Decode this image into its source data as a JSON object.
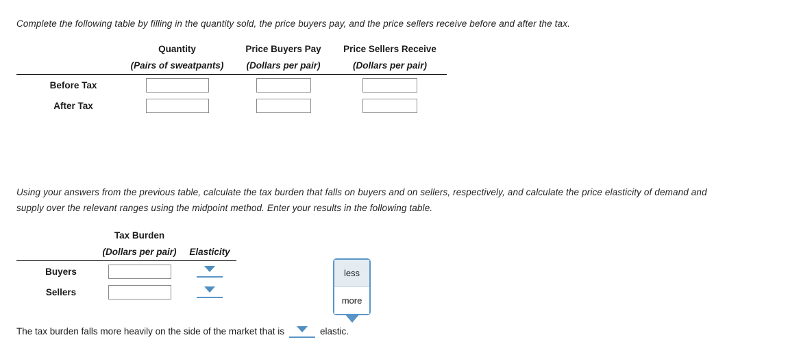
{
  "prompts": {
    "first": "Complete the following table by filling in the quantity sold, the price buyers pay, and the price sellers receive before and after the tax.",
    "second": "Using your answers from the previous table, calculate the tax burden that falls on buyers and on sellers, respectively, and calculate the price elasticity of demand and supply over the relevant ranges using the midpoint method. Enter your results in the following table."
  },
  "table_one": {
    "headers_main": [
      "",
      "Quantity",
      "Price Buyers Pay",
      "Price Sellers Receive"
    ],
    "headers_sub": [
      "",
      "(Pairs of sweatpants)",
      "(Dollars per pair)",
      "(Dollars per pair)"
    ],
    "rows": [
      {
        "label": "Before Tax",
        "quantity": "",
        "price_buyers_pay": "",
        "price_sellers_receive": ""
      },
      {
        "label": "After Tax",
        "quantity": "",
        "price_buyers_pay": "",
        "price_sellers_receive": ""
      }
    ],
    "input_placeholder": ""
  },
  "table_two": {
    "headers_main": [
      "",
      "Tax Burden",
      ""
    ],
    "headers_sub": [
      "",
      "(Dollars per pair)",
      "Elasticity"
    ],
    "rows": [
      {
        "label": "Buyers",
        "tax_burden": "",
        "elasticity": ""
      },
      {
        "label": "Sellers",
        "tax_burden": "",
        "elasticity": ""
      }
    ],
    "input_placeholder": "",
    "elasticity_options": [
      "less",
      "more"
    ]
  },
  "dropdown_popup": {
    "options": [
      "less",
      "more"
    ],
    "highlighted": "less"
  },
  "closing": {
    "text_before": "The tax burden falls more heavily on the side of the market that is",
    "text_after": "elastic.",
    "selected_value": ""
  },
  "colors": {
    "dropdown_blue": "#5a95c8",
    "triangle_blue": "#4f8fc0",
    "popup_highlight": "#e4ecf2",
    "input_border": "#8a8a8a",
    "rule": "#000000"
  }
}
